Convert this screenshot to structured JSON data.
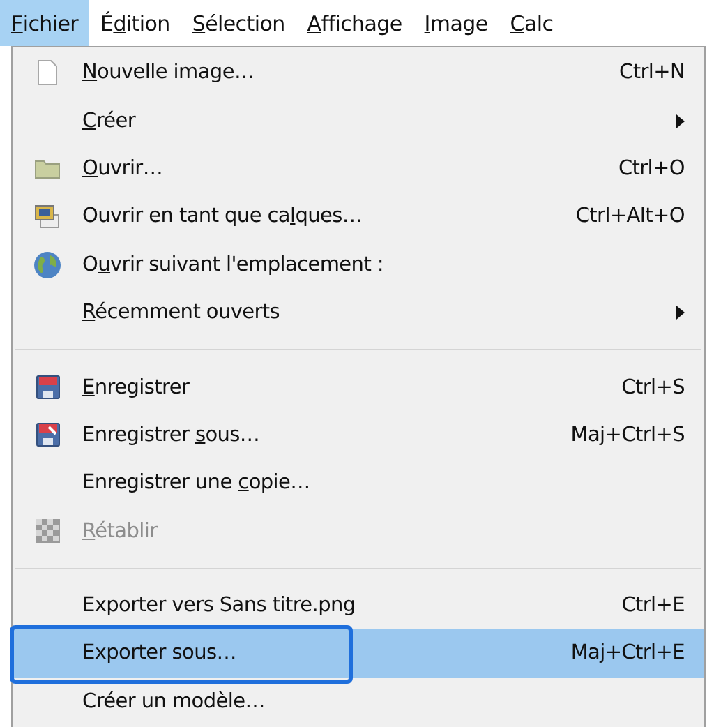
{
  "menu_bar": [
    {
      "key": "F",
      "post": "ichier",
      "selected": true
    },
    {
      "pre": "É",
      "key": "d",
      "post": "ition",
      "selected": false
    },
    {
      "key": "S",
      "post": "élection",
      "selected": false
    },
    {
      "key": "A",
      "post": "ffichage",
      "selected": false
    },
    {
      "key": "I",
      "post": "mage",
      "selected": false
    },
    {
      "key": "C",
      "post": "alc",
      "selected": false
    }
  ],
  "menu": {
    "groups": [
      [
        {
          "key": "N",
          "post": "ouvelle image…",
          "shortcut": "Ctrl+N",
          "submenu": false,
          "disabled": false,
          "selected": false
        },
        {
          "key": "C",
          "post": "réer",
          "submenu": true,
          "disabled": false,
          "selected": false
        },
        {
          "key": "O",
          "post": "uvrir…",
          "shortcut": "Ctrl+O",
          "submenu": false,
          "disabled": false,
          "selected": false
        },
        {
          "pre": "Ouvrir en tant que ca",
          "key": "l",
          "post": "ques…",
          "shortcut": "Ctrl+Alt+O",
          "submenu": false,
          "disabled": false,
          "selected": false
        },
        {
          "pre": "O",
          "key": "u",
          "post": "vrir suivant l'emplacement :",
          "submenu": false,
          "disabled": false,
          "selected": false
        },
        {
          "key": "R",
          "post": "écemment ouverts",
          "submenu": true,
          "disabled": false,
          "selected": false
        }
      ],
      [
        {
          "key": "E",
          "post": "nregistrer",
          "shortcut": "Ctrl+S",
          "submenu": false,
          "disabled": false,
          "selected": false
        },
        {
          "pre": "Enregistrer ",
          "key": "s",
          "post": "ous…",
          "shortcut": "Maj+Ctrl+S",
          "submenu": false,
          "disabled": false,
          "selected": false
        },
        {
          "pre": "Enregistrer une ",
          "key": "c",
          "post": "opie…",
          "submenu": false,
          "disabled": false,
          "selected": false
        },
        {
          "key": "R",
          "post": "établir",
          "submenu": false,
          "disabled": true,
          "selected": false
        }
      ],
      [
        {
          "pre": "Exporter vers Sans titre.png",
          "shortcut": "Ctrl+E",
          "submenu": false,
          "disabled": false,
          "selected": false
        },
        {
          "pre": "Exporter sous…",
          "shortcut": "Maj+Ctrl+E",
          "submenu": false,
          "disabled": false,
          "selected": true,
          "annotated": true
        },
        {
          "pre": "Créer un modèle…",
          "submenu": false,
          "disabled": false,
          "selected": false
        }
      ]
    ]
  }
}
